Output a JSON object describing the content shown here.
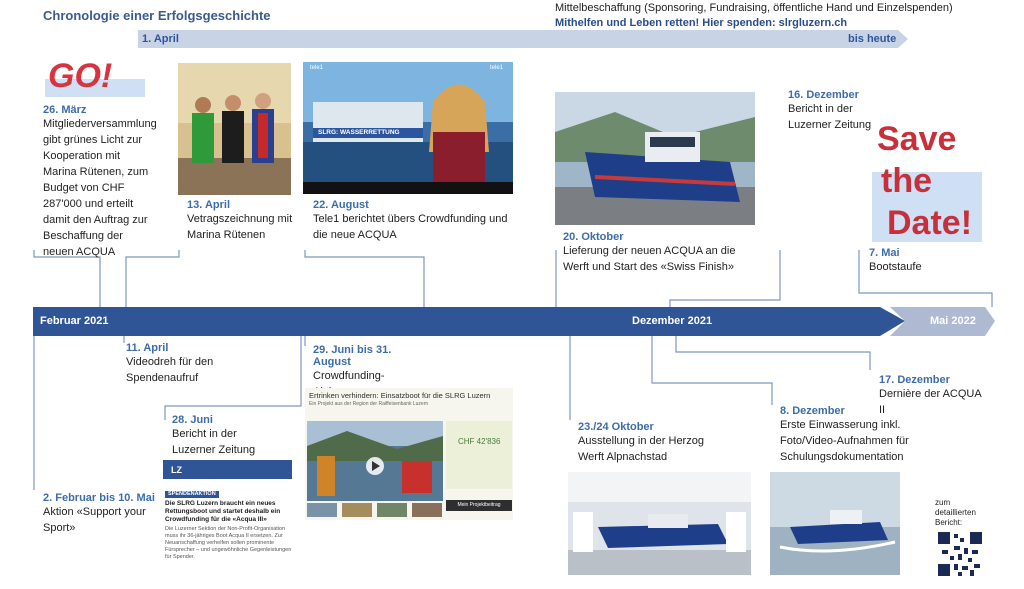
{
  "title": "Chronologie einer Erfolgsgeschichte",
  "top_note": {
    "line1": "Mittelbeschaffung (Sponsoring, Fundraising, öffentliche Hand und Einzelspenden)",
    "line2": "Mithelfen und Leben retten! Hier spenden: slrgluzern.ch"
  },
  "top_bar": {
    "start": "1. April",
    "end": "bis heute"
  },
  "main_bar": {
    "left": "Februar 2021",
    "mid": "Dezember 2021",
    "right": "Mai 2022"
  },
  "stickers": {
    "go": "GO!",
    "save1": "Save",
    "save2": "the",
    "save3": "Date!"
  },
  "events": {
    "e_26maerz": {
      "date": "26. März",
      "text": "Mitgliederversammlung gibt grünes Licht zur Kooperation mit Marina Rütenen, zum Budget von CHF 287'000 und erteilt damit den Auftrag zur Beschaffung der neuen ACQUA"
    },
    "e_13april": {
      "date": "13. April",
      "text": "Vetragszeichnung mit Marina Rütenen"
    },
    "e_22aug": {
      "date": "22. August",
      "text": "Tele1 berichtet übers Crowdfunding und die neue ACQUA"
    },
    "e_20okt": {
      "date": "20. Oktober",
      "text": "Lieferung der neuen ACQUA an die Werft und Start des «Swiss Finish»"
    },
    "e_16dez": {
      "date": "16. Dezember",
      "text": "Bericht in der Luzerner Zeitung"
    },
    "e_7mai": {
      "date": "7. Mai",
      "text": "Bootstaufe"
    },
    "e_11april": {
      "date": "11. April",
      "text": "Videodreh für den Spendenaufruf"
    },
    "e_28juni": {
      "date": "28. Juni",
      "text": "Bericht in der Luzerner Zeitung"
    },
    "e_2feb": {
      "date": "2. Februar bis 10. Mai",
      "text": "Aktion «Support your Sport»"
    },
    "e_29juni": {
      "date": "29. Juni bis 31. August",
      "text": "Crowdfunding-Aktion"
    },
    "e_2324okt": {
      "date": "23./24 Oktober",
      "text": "Ausstellung in der Herzog Werft Alpnachstad"
    },
    "e_8dez": {
      "date": "8. Dezember",
      "text": "Erste Einwasserung inkl. Foto/Video-Aufnahmen für Schulungsdokumentation"
    },
    "e_17dez": {
      "date": "17. Dezember",
      "text": "Dernière der ACQUA II"
    }
  },
  "news_clip": {
    "logo": "LZ",
    "tag": "SPENDENAKTION",
    "headline": "Die SLRG Luzern braucht ein neues Rettungsboot und startet deshalb ein Crowdfunding für die «Acqua III»",
    "body": "Die Luzerner Sektion der Non-Profit-Organisation muss ihr 36-jähriges Boot Acqua II ersetzen. Zur Neuanschaffung verhelfen sollen prominente Fürsprecher – und ungewöhnliche Gegenleistungen für Spender."
  },
  "crowdfunding": {
    "title": "Ertrinken verhindern: Einsatzboot für die SLRG Luzern",
    "sub": "Ein Projekt aus der Region der Raiffeisenbank Luzern",
    "amount": "CHF 42'836",
    "button": "Mein Projektbeitrag"
  },
  "tele_logo": "tele1",
  "tele_banner": "SLRG: WASSERRETTUNG",
  "qr_label": "zum detaillierten Bericht:",
  "colors": {
    "bar": "#2f5597",
    "bar_light": "#aeb9d2",
    "date": "#3d6cab",
    "sticker_red": "#d8333e",
    "sticker_bg": "#cfe0f4"
  }
}
